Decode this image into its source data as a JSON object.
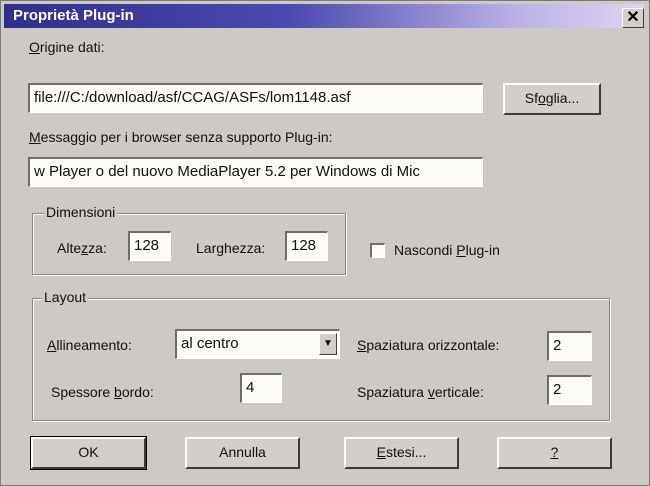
{
  "window": {
    "title": "Proprietà Plug-in",
    "close_glyph": "✕"
  },
  "source": {
    "label_prefix": "O",
    "label_rest": "rigine dati:",
    "value": "file:///C:/download/asf/CCAG/ASFs/lom1148.asf",
    "browse_prefix": "Sf",
    "browse_u": "o",
    "browse_rest": "glia..."
  },
  "message": {
    "label_prefix": "M",
    "label_rest": "essaggio per i browser senza supporto Plug-in:",
    "value": "w Player o del nuovo MediaPlayer 5.2 per Windows di Mic"
  },
  "dimensions": {
    "legend": "Dimensioni",
    "height_label_a": "Alte",
    "height_label_u": "z",
    "height_label_b": "za:",
    "height_value": "128",
    "width_label_a": "Lar",
    "width_label_u": "g",
    "width_label_b": "hezza:",
    "width_value": "128"
  },
  "hide_plugin": {
    "label_a": "Nascondi ",
    "label_u": "P",
    "label_b": "lug-in",
    "checked": false
  },
  "layout": {
    "legend": "Layout",
    "align_label_u": "A",
    "align_label_rest": "llineamento:",
    "align_value": "al centro",
    "border_label_a": "Spessore ",
    "border_label_u": "b",
    "border_label_b": "ordo:",
    "border_value": "4",
    "hspace_label_a": "",
    "hspace_label_u": "S",
    "hspace_label_b": "paziatura orizzontale:",
    "hspace_value": "2",
    "vspace_label_a": "Spaziatura ",
    "vspace_label_u": "v",
    "vspace_label_b": "erticale:",
    "vspace_value": "2"
  },
  "buttons": {
    "ok": "OK",
    "cancel": "Annulla",
    "extended_u": "E",
    "extended_rest": "stesi...",
    "help": "?"
  }
}
